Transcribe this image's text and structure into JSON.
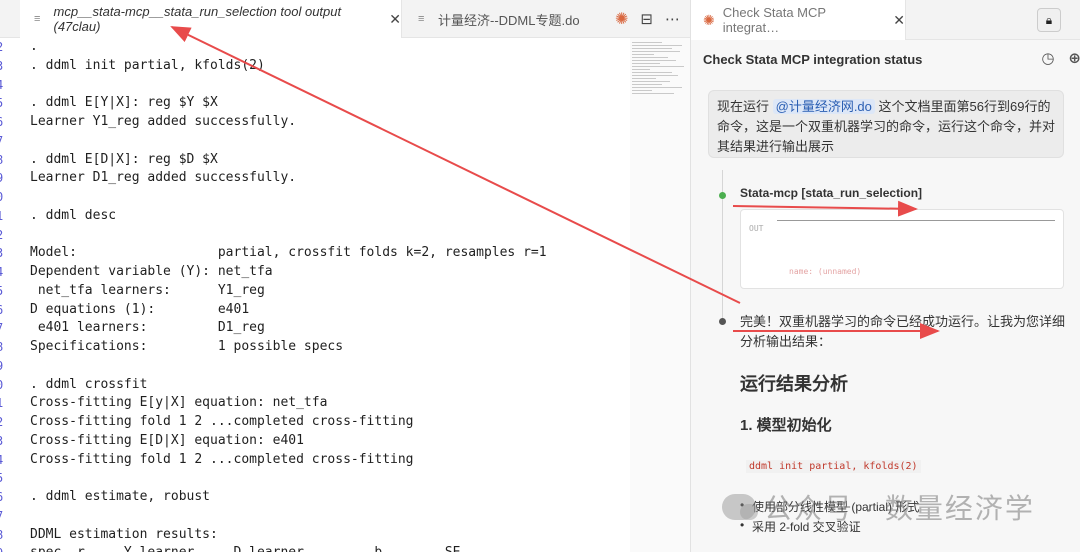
{
  "editor": {
    "tabs": [
      {
        "label": "mcp__stata-mcp__stata_run_selection tool output (47clau)",
        "close": "✕"
      },
      {
        "label": "计量经济--DDML专题.do"
      }
    ],
    "lines": [
      {
        "n": "2",
        "t": "."
      },
      {
        "n": "3",
        "t": ". ddml init partial, kfolds(2)"
      },
      {
        "n": "4",
        "t": ""
      },
      {
        "n": "5",
        "t": ". ddml E[Y|X]: reg $Y $X"
      },
      {
        "n": "6",
        "t": "Learner Y1_reg added successfully."
      },
      {
        "n": "7",
        "t": ""
      },
      {
        "n": "8",
        "t": ". ddml E[D|X]: reg $D $X"
      },
      {
        "n": "9",
        "t": "Learner D1_reg added successfully."
      },
      {
        "n": "0",
        "t": ""
      },
      {
        "n": "1",
        "t": ". ddml desc"
      },
      {
        "n": "2",
        "t": ""
      },
      {
        "n": "3",
        "t": "Model:                  partial, crossfit folds k=2, resamples r=1"
      },
      {
        "n": "4",
        "t": "Dependent variable (Y): net_tfa"
      },
      {
        "n": "5",
        "t": " net_tfa learners:      Y1_reg"
      },
      {
        "n": "6",
        "t": "D equations (1):        e401"
      },
      {
        "n": "7",
        "t": " e401 learners:         D1_reg"
      },
      {
        "n": "8",
        "t": "Specifications:         1 possible specs"
      },
      {
        "n": "9",
        "t": ""
      },
      {
        "n": "0",
        "t": ". ddml crossfit"
      },
      {
        "n": "1",
        "t": "Cross-fitting E[y|X] equation: net_tfa"
      },
      {
        "n": "2",
        "t": "Cross-fitting fold 1 2 ...completed cross-fitting"
      },
      {
        "n": "3",
        "t": "Cross-fitting E[D|X] equation: e401"
      },
      {
        "n": "4",
        "t": "Cross-fitting fold 1 2 ...completed cross-fitting"
      },
      {
        "n": "5",
        "t": ""
      },
      {
        "n": "6",
        "t": ". ddml estimate, robust"
      },
      {
        "n": "7",
        "t": ""
      },
      {
        "n": "8",
        "t": "DDML estimation results:"
      },
      {
        "n": "9",
        "t": "spec  r     Y learner     D learner         b        SE"
      }
    ]
  },
  "chat": {
    "tab_label": "Check Stata MCP integrat…",
    "tab_close": "✕",
    "title": "Check Stata MCP integration status",
    "user_msg_prefix": "现在运行 ",
    "mention": "@计量经济网.do",
    "user_msg_suffix": " 这个文档里面第56行到69行的命令，这是一个双重机器学习的命令，运行这个命令，并对其结果进行输出展示",
    "tool_name": "Stata-mcp [stata_run_selection]",
    "out_label": "OUT",
    "out_faded": "name: (unnamed)",
    "reply": "完美！双重机器学习的命令已经成功运行。让我为您详细分析输出结果：",
    "h2": "运行结果分析",
    "h3": "1. 模型初始化",
    "code_chip": "ddml init partial, kfolds(2)",
    "bullets": [
      "使用部分线性模型 (partial) 形式",
      "采用 2-fold 交叉验证"
    ]
  },
  "watermark": "公众号 · 数量经济学",
  "colors": {
    "arrow": "#e84b4b",
    "accent": "#d9673f"
  }
}
